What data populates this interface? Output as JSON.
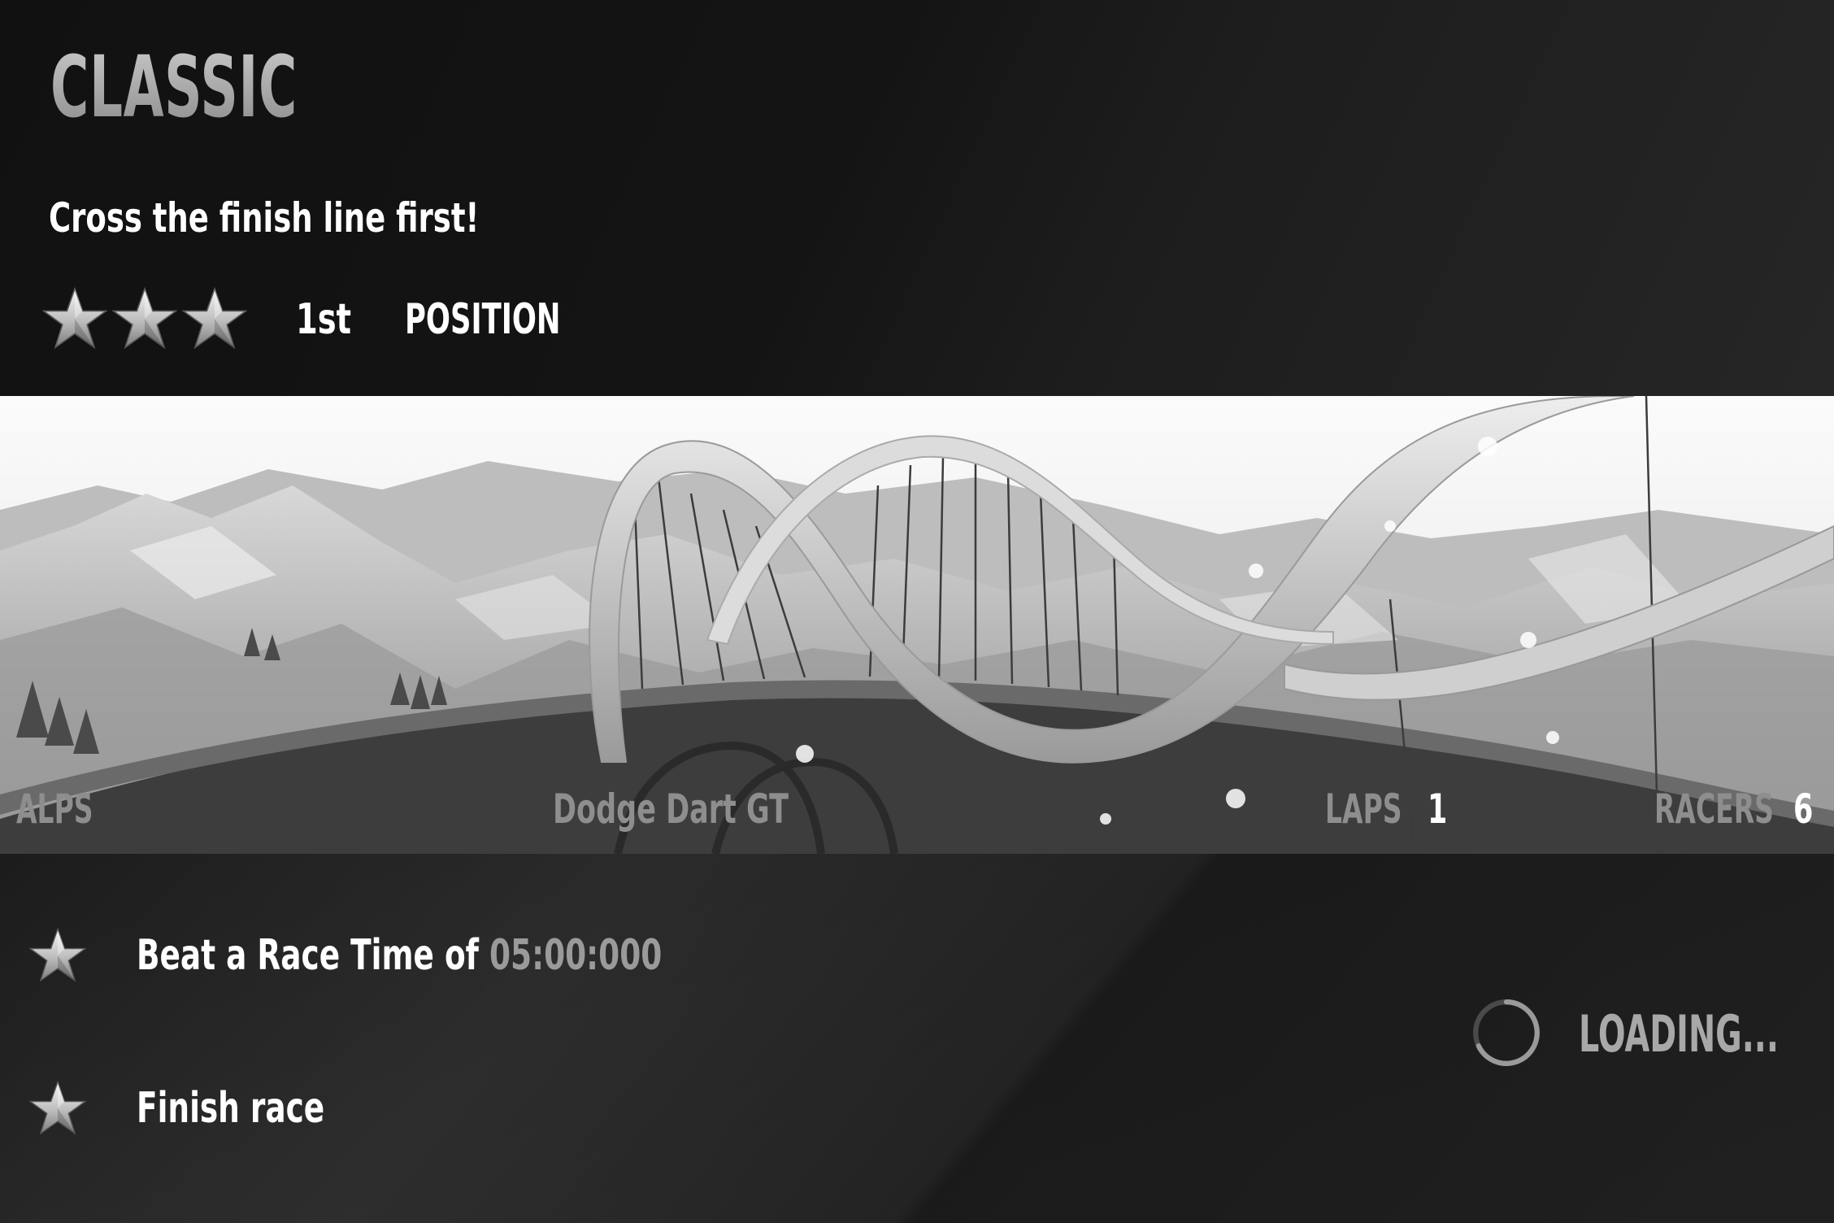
{
  "mode": {
    "title": "CLASSIC",
    "description": "Cross the finish line first!"
  },
  "position_goal": {
    "stars": 3,
    "value": "1st",
    "label": "POSITION"
  },
  "race_info": {
    "track": "ALPS",
    "car": "Dodge Dart GT",
    "laps_label": "LAPS",
    "laps_value": "1",
    "racers_label": "RACERS",
    "racers_value": "6"
  },
  "objectives": [
    {
      "stars": 1,
      "text": "Beat a Race Time of ",
      "highlight": "05:00:000"
    },
    {
      "stars": 1,
      "text": "Finish race"
    }
  ],
  "status": {
    "loading_text": "LOADING..."
  },
  "icons": {
    "star": "star-icon",
    "spinner": "loading-spinner-icon"
  },
  "colors": {
    "title": "#9c9c9c",
    "text": "#ffffff",
    "muted": "#8e8e8e",
    "highlight": "#9a9a9a",
    "star": "#d8d8d8"
  }
}
